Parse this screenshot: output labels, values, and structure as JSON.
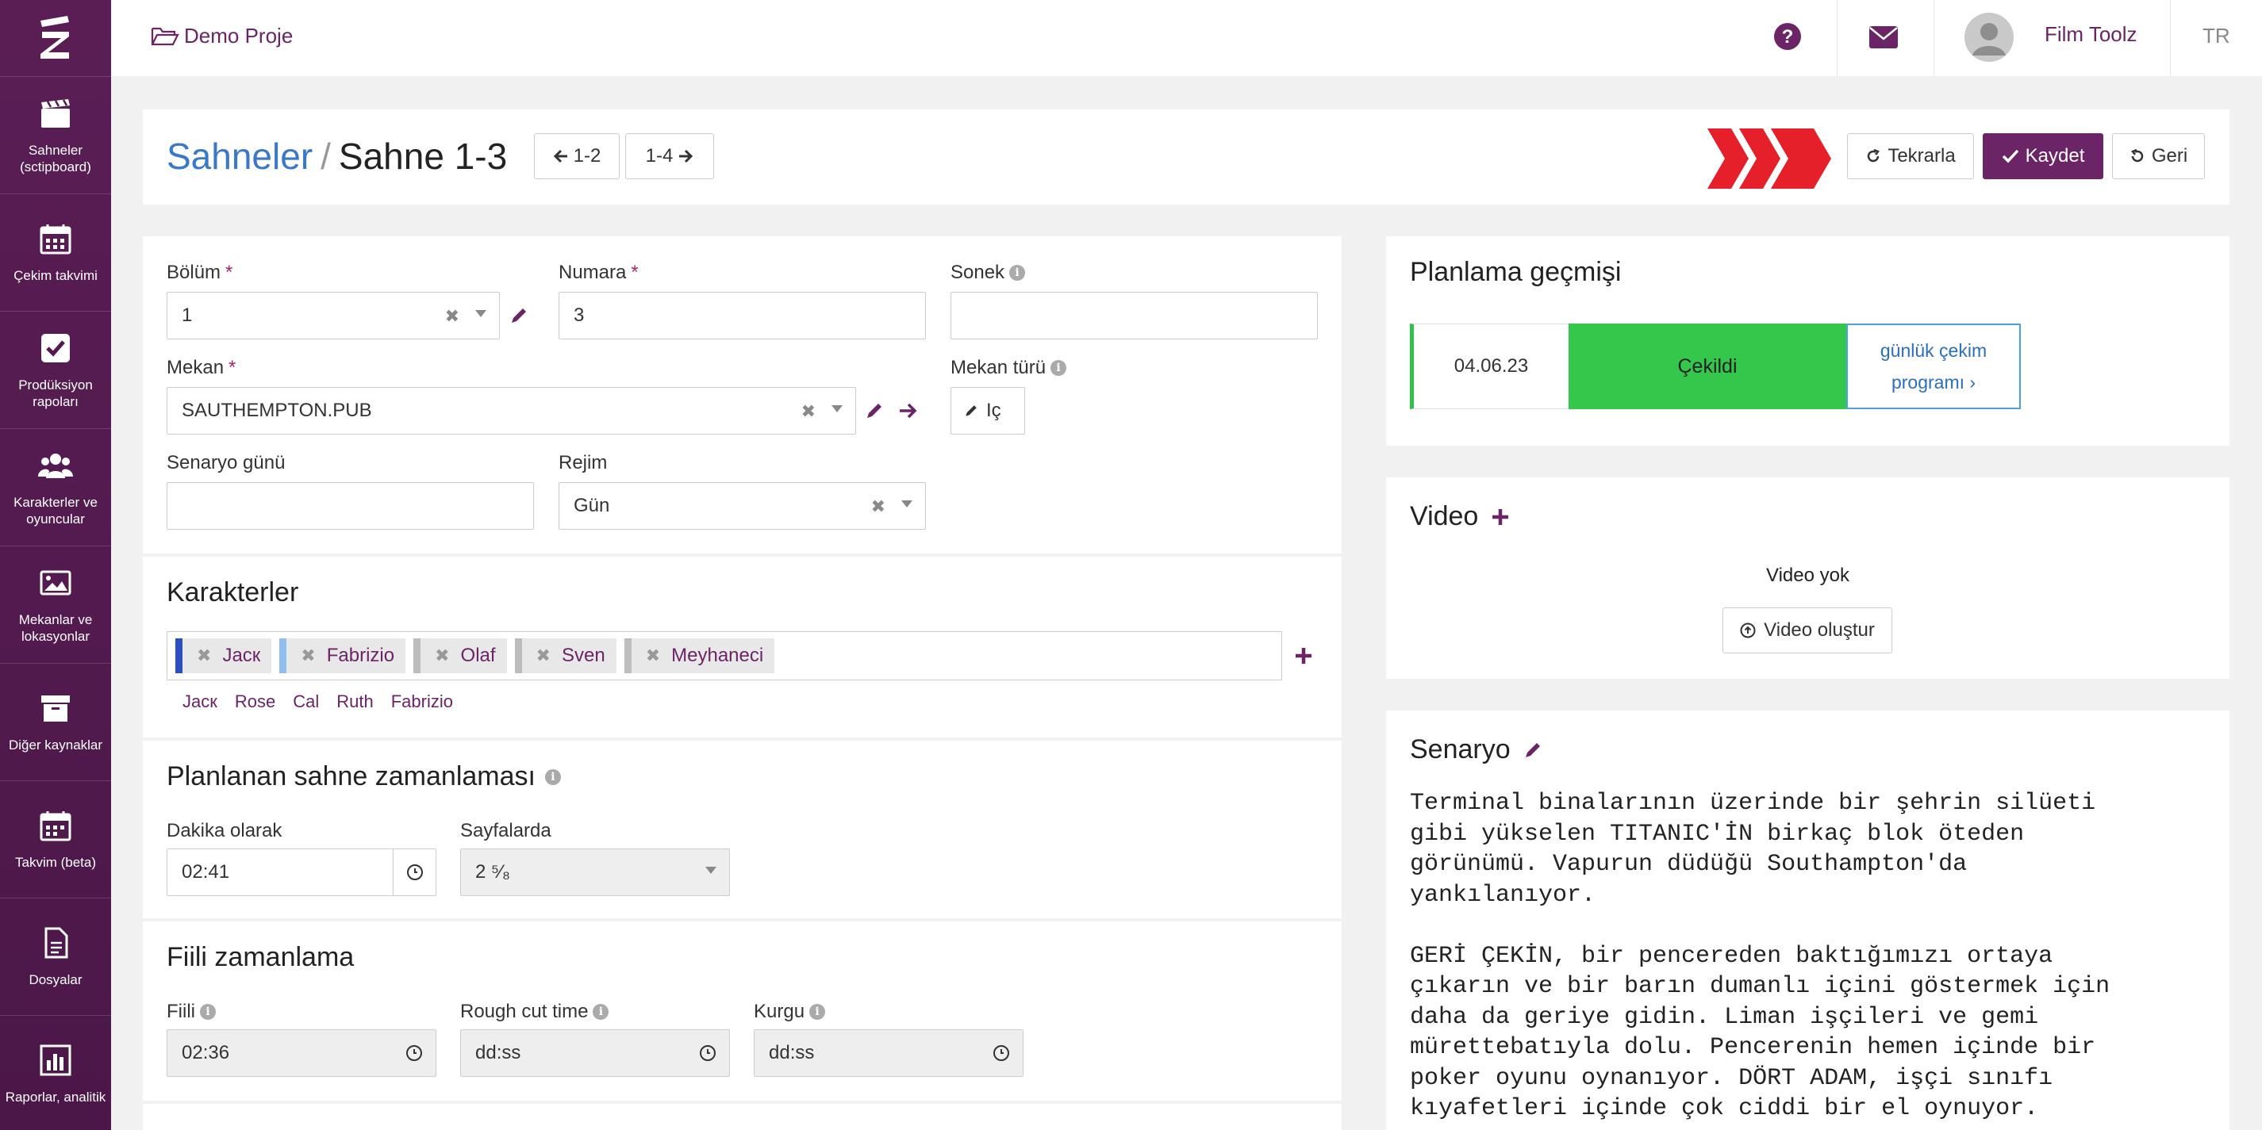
{
  "colors": {
    "brand": "#6b2466",
    "sidebar": "#55194f",
    "link_blue": "#3a78c9",
    "success": "#35c64c",
    "accent_red": "#e5202a"
  },
  "sidebar": {
    "items": [
      {
        "label": "Sahneler (sctipboard)",
        "icon": "clapperboard-icon"
      },
      {
        "label": "Çekim takvimi",
        "icon": "calendar-icon"
      },
      {
        "label": "Prodüksiyon rapoları",
        "icon": "checkbox-icon"
      },
      {
        "label": "Karakterler ve oyuncular",
        "icon": "users-icon"
      },
      {
        "label": "Mekanlar ve lokasyonlar",
        "icon": "image-icon"
      },
      {
        "label": "Diğer kaynaklar",
        "icon": "archive-icon"
      },
      {
        "label": "Takvim (beta)",
        "icon": "calendar-grid-icon"
      },
      {
        "label": "Dosyalar",
        "icon": "file-icon"
      },
      {
        "label": "Raporlar, analitik",
        "icon": "bar-chart-icon"
      }
    ]
  },
  "topbar": {
    "project": "Demo Proje",
    "user": "Film Toolz",
    "lang": "TR"
  },
  "header": {
    "section_link": "Sahneler",
    "separator": "/",
    "current": "Sahne 1-3",
    "prev_scene": "1-2",
    "next_scene": "1-4",
    "repeat_label": "Tekrarla",
    "save_label": "Kaydet",
    "back_label": "Geri"
  },
  "form": {
    "bolum_label": "Bölüm",
    "bolum_value": "1",
    "numara_label": "Numara",
    "numara_value": "3",
    "sonek_label": "Sonek",
    "sonek_value": "",
    "mekan_label": "Mekan",
    "mekan_value": "SAUTHEMPTON.PUB",
    "mekan_turu_label": "Mekan türü",
    "mekan_turu_value": "Iç",
    "senaryo_gunu_label": "Senaryo günü",
    "senaryo_gunu_value": "",
    "rejim_label": "Rejim",
    "rejim_value": "Gün",
    "required_mark": "*"
  },
  "characters": {
    "title": "Karakterler",
    "tags": [
      {
        "name": "Jacк",
        "color": "#2a4fc0"
      },
      {
        "name": "Fabrizio",
        "color": "#8fbfea"
      },
      {
        "name": "Olaf",
        "color": "#bdbdbd"
      },
      {
        "name": "Sven",
        "color": "#bdbdbd"
      },
      {
        "name": "Meyhaneci",
        "color": "#bdbdbd"
      }
    ],
    "suggestions": [
      "Jacк",
      "Rose",
      "Cal",
      "Ruth",
      "Fabrizio"
    ]
  },
  "planned": {
    "title": "Planlanan sahne zamanlaması",
    "minutes_label": "Dakika olarak",
    "minutes_value": "02:41",
    "pages_label": "Sayfalarda",
    "pages_value": "2 ⁵⁄₈"
  },
  "actual": {
    "title": "Fiili zamanlama",
    "fiili_label": "Fiili",
    "fiili_value": "02:36",
    "rough_label": "Rough cut time",
    "rough_placeholder": "dd:ss",
    "kurgu_label": "Kurgu",
    "kurgu_placeholder": "dd:ss"
  },
  "history": {
    "title": "Planlama geçmişi",
    "date": "04.06.23",
    "status": "Çekildi",
    "link": "günlük çekim programı ›"
  },
  "video": {
    "title": "Video",
    "empty": "Video yok",
    "create_label": "Video oluştur"
  },
  "script": {
    "title": "Senaryo",
    "text": "Terminal binalarının üzerinde bir şehrin silüeti\ngibi yükselen TITANIC'İN birkaç blok öteden\ngörünümü. Vapurun düdüğü Southampton'da\nyankılanıyor.\n\nGERİ ÇEKİN, bir pencereden baktığımızı ortaya\nçıkarın ve bir barın dumanlı içini göstermek için\ndaha da geriye gidin. Liman işçileri ve gemi\nmürettebatıyla dolu. Pencerenin hemen içinde bir\npoker oyunu oynanıyor. DÖRT ADAM, işçi sınıfı\nkıyafetleri içinde çok ciddi bir el oynuyor."
  }
}
